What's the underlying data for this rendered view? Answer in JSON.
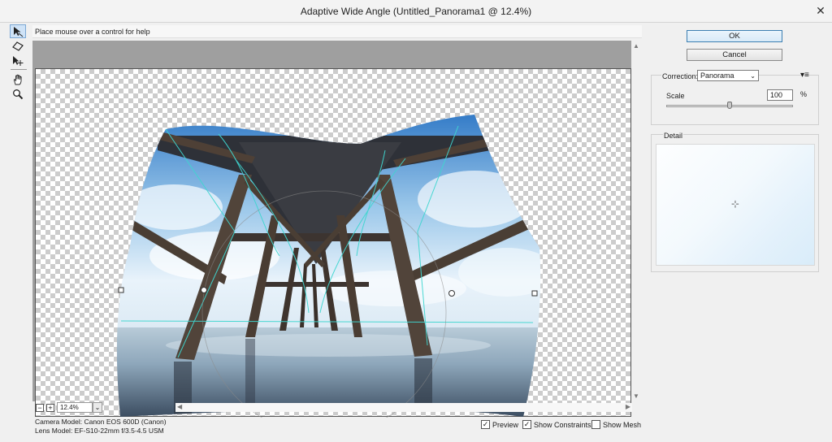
{
  "window": {
    "title": "Adaptive Wide Angle (Untitled_Panorama1 @ 12.4%)",
    "close_glyph": "✕"
  },
  "toolbar": {
    "tools": [
      {
        "name": "constraint-tool-icon",
        "active": true
      },
      {
        "name": "polygon-constraint-tool-icon",
        "active": false
      },
      {
        "name": "move-tool-icon",
        "active": false
      },
      {
        "name": "hand-tool-icon",
        "active": false
      },
      {
        "name": "zoom-tool-icon",
        "active": false
      }
    ]
  },
  "help": {
    "text": "Place mouse over a control for help"
  },
  "zoom": {
    "minus": "−",
    "plus": "+",
    "value": "12.4%",
    "drop": "⌄"
  },
  "status": {
    "camera": "Camera Model: Canon EOS 600D (Canon)",
    "lens": "Lens Model: EF-S10-22mm f/3.5-4.5 USM"
  },
  "checkboxes": {
    "preview": {
      "label": "Preview",
      "checked": true
    },
    "constraints": {
      "label": "Show Constraints",
      "checked": true
    },
    "mesh": {
      "label": "Show Mesh",
      "checked": false
    }
  },
  "buttons": {
    "ok": "OK",
    "cancel": "Cancel"
  },
  "correction": {
    "label": "Correction:",
    "value": "Panorama",
    "menu_glyph": "▾≡"
  },
  "scale": {
    "label": "Scale",
    "value": "100",
    "unit": "%",
    "slider_fraction": 0.5
  },
  "detail": {
    "label": "Detail",
    "crosshair": "⊹"
  },
  "colors": {
    "accent": "#3c7fb1",
    "constraint_line": "#3fd6d0",
    "canvas_bg": "#9f9f9f"
  }
}
